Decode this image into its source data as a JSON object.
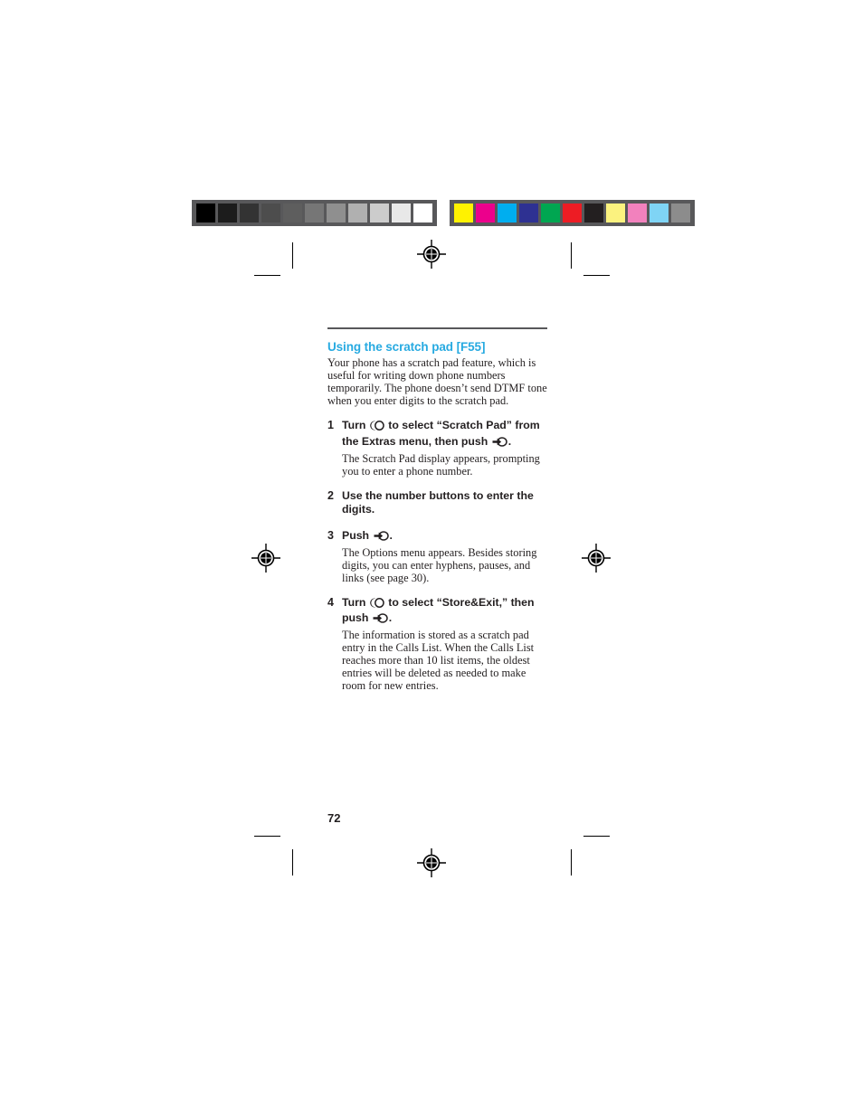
{
  "page": {
    "folio": "72",
    "heading": "Using the scratch pad [F55]",
    "heading_color": "#27aae1",
    "intro": "Your phone has a scratch pad feature, which is useful for writing down phone numbers temporarily. The phone doesn’t send DTMF tone when you enter digits to the scratch pad.",
    "rule_color": "#58585a"
  },
  "steps": [
    {
      "number": "1",
      "title_before_dial": "Turn",
      "dial_icon": "jog-dial-icon",
      "title_after_dial": "to select “Scratch Pad” from the Extras menu, then push",
      "push_icon": "jog-push-icon",
      "title_end": ".",
      "detail": "The Scratch Pad display appears, prompting you to enter a phone number."
    },
    {
      "number": "2",
      "title_plain": "Use the number buttons to enter the digits.",
      "detail": ""
    },
    {
      "number": "3",
      "title_before_push": "Push",
      "push_icon": "jog-push-icon",
      "title_end": ".",
      "detail": "The Options menu appears. Besides storing digits, you can enter hyphens, pauses, and links (see page 30)."
    },
    {
      "number": "4",
      "title_before_dial": "Turn",
      "dial_icon": "jog-dial-icon",
      "title_after_dial": "to select “Store&Exit,” then push",
      "push_icon": "jog-push-icon",
      "title_end": ".",
      "detail": "The information is stored as a scratch pad entry in the Calls List. When the Calls List reaches more than 10 list items, the oldest entries will be deleted as needed to make room for new entries."
    }
  ],
  "calibration": {
    "bar_background": "#58585a",
    "grayscale_label": "grayscale-step-wedge",
    "grayscale_patches": [
      "#000000",
      "#1c1c1c",
      "#333333",
      "#4d4d4d",
      "#5e5e5e",
      "#767676",
      "#8f8f8f",
      "#b0b0b0",
      "#cccccc",
      "#e8e8e8",
      "#ffffff"
    ],
    "color_label": "process-color-control-strip",
    "color_patches": [
      "#fff200",
      "#ec008c",
      "#00aeef",
      "#2e3192",
      "#00a651",
      "#ed1c24",
      "#231f20",
      "#fdf287",
      "#f津",
      "#f versus"
    ],
    "color_patches_fixed": [
      "#fff200",
      "#ec008c",
      "#00aeef",
      "#2e3192",
      "#00a651",
      "#ed1c24",
      "#231f20",
      "#fbf27f",
      "#f281bd",
      "#7fd4f5",
      "#8c8c8c"
    ]
  },
  "marks": {
    "registration_name": "registration-target",
    "crop_name": "crop-mark"
  }
}
